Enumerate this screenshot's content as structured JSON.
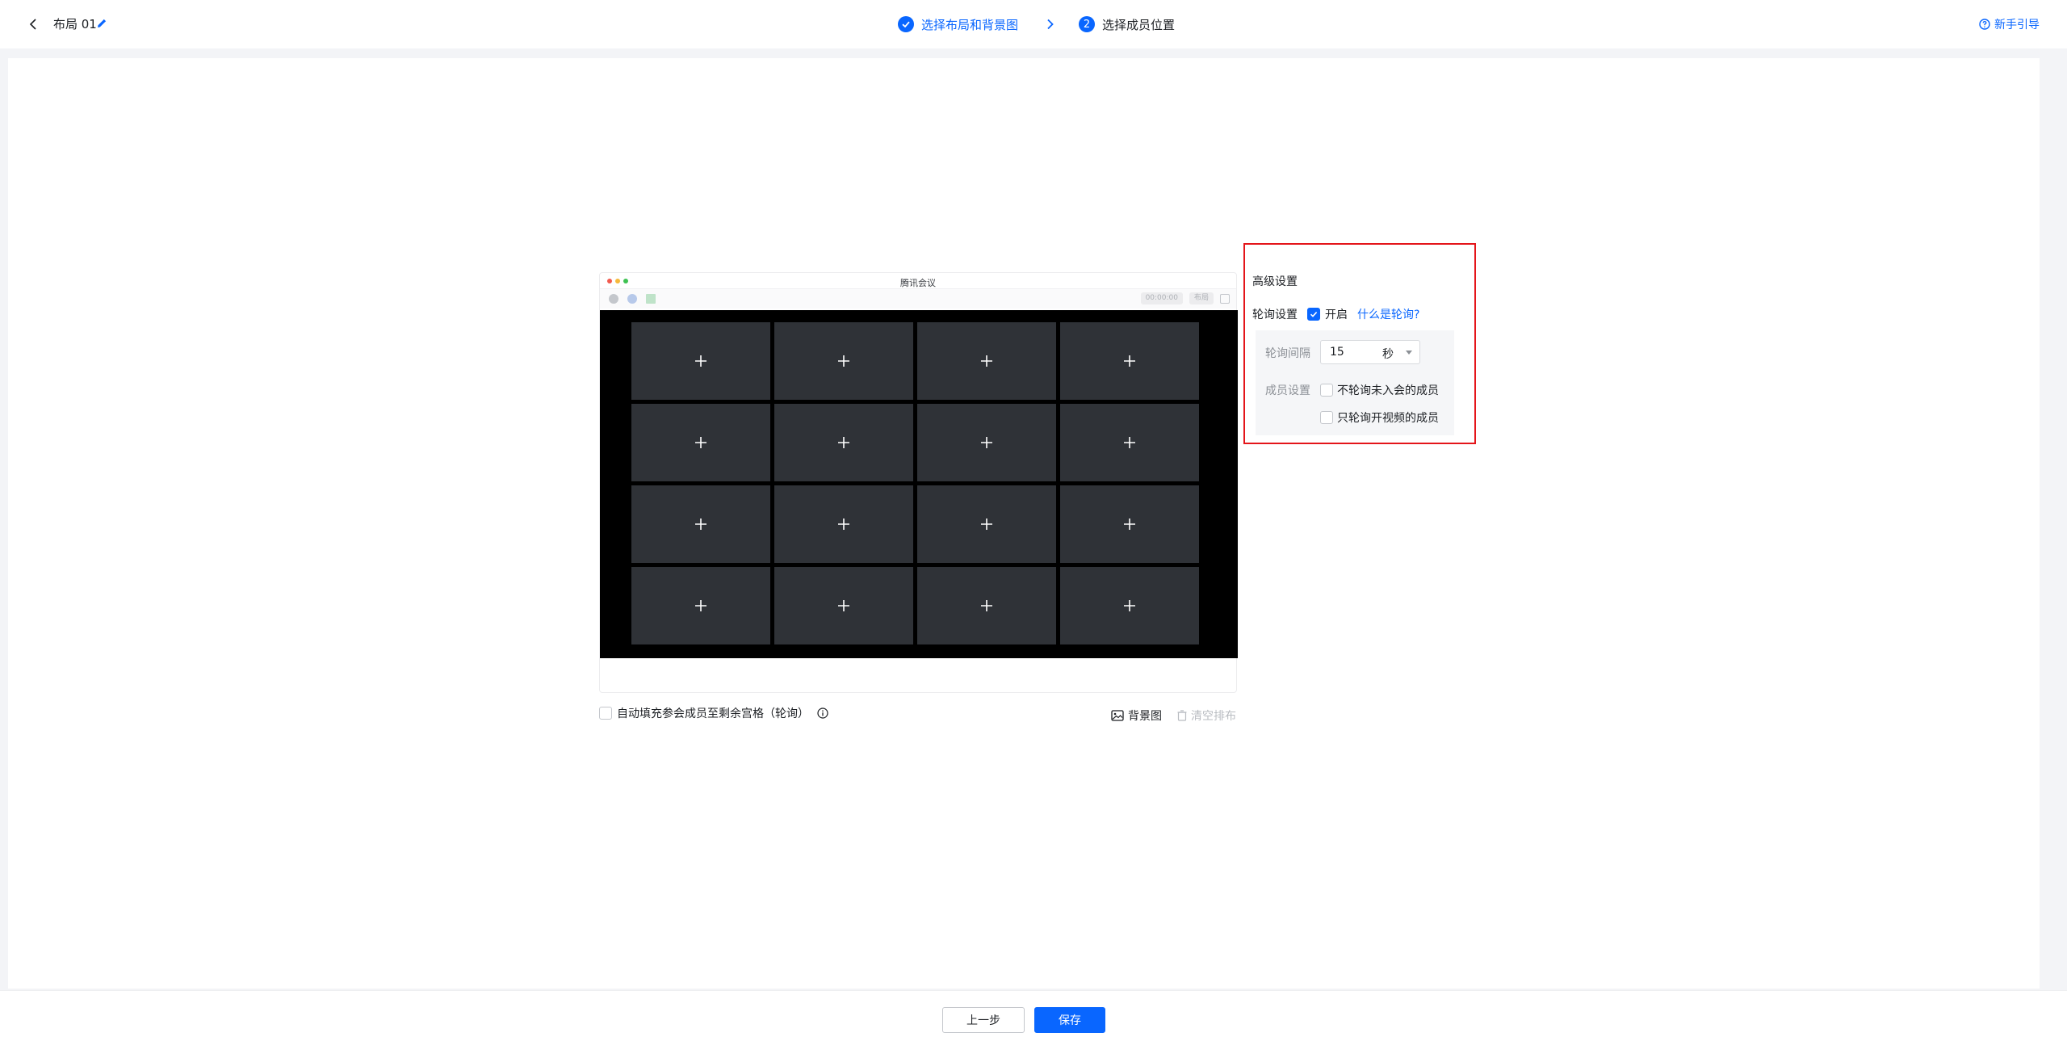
{
  "header": {
    "layout_name": "布局 01",
    "steps": [
      {
        "index": "1",
        "label": "选择布局和背景图",
        "status": "done"
      },
      {
        "index": "2",
        "label": "选择成员位置",
        "status": "current"
      }
    ],
    "guide_label": "新手引导"
  },
  "preview": {
    "window_title": "腾讯会议",
    "toolbar_time": "00:00:00",
    "toolbar_layout": "布局",
    "cells": [
      "+",
      "+",
      "+",
      "+",
      "+",
      "+",
      "+",
      "+",
      "+",
      "+",
      "+",
      "+",
      "+",
      "+",
      "+",
      "+"
    ]
  },
  "below_preview": {
    "autofill_label": "自动填充参会成员至剩余宫格（轮询）",
    "autofill_checked": false,
    "background_label": "背景图",
    "clear_label": "清空排布"
  },
  "advanced": {
    "title": "高级设置",
    "polling_label": "轮询设置",
    "polling_enabled_label": "开启",
    "polling_enabled": true,
    "what_is_polling_link": "什么是轮询?",
    "interval_label": "轮询间隔",
    "interval_value": "15",
    "interval_unit": "秒",
    "member_label": "成员设置",
    "option_not_joined": "不轮询未入会的成员",
    "option_video_only": "只轮询开视频的成员"
  },
  "footer": {
    "prev_label": "上一步",
    "save_label": "保存"
  },
  "colors": {
    "accent": "#0966ff",
    "highlight_border": "#e4151a",
    "stage_bg": "#000000",
    "cell_bg": "#2f3237"
  }
}
